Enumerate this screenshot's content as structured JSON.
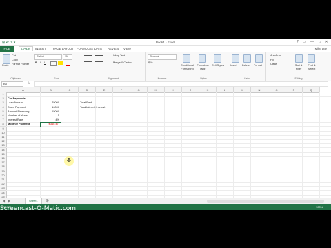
{
  "window": {
    "title": "Book1 - Excel",
    "user": "Mike Lee"
  },
  "quick_access": "⊞ ↶ ↷ ▾",
  "controls": [
    "?",
    "▭",
    "—",
    "□",
    "✕"
  ],
  "tabs": [
    "FILE",
    "HOME",
    "INSERT",
    "PAGE LAYOUT",
    "FORMULAS",
    "DATA",
    "REVIEW",
    "VIEW"
  ],
  "ribbon": {
    "clipboard": {
      "paste": "Paste",
      "cut": "Cut",
      "copy": "Copy",
      "format_painter": "Format Painter",
      "label": "Clipboard"
    },
    "font": {
      "name": "Calibri",
      "size": "11",
      "bold": "B",
      "italic": "I",
      "underline": "U",
      "label": "Font"
    },
    "alignment": {
      "wrap": "Wrap Text",
      "merge": "Merge & Center",
      "label": "Alignment"
    },
    "number": {
      "format": "General",
      "label": "Number"
    },
    "styles": {
      "conditional": "Conditional Formatting",
      "format_table": "Format as Table",
      "cell_styles": "Cell Styles",
      "label": "Styles"
    },
    "cells": {
      "insert": "Insert",
      "delete": "Delete",
      "format": "Format",
      "label": "Cells"
    },
    "editing": {
      "autosum": "AutoSum",
      "fill": "Fill",
      "clear": "Clear",
      "sort": "Sort & Filter",
      "find": "Find & Select",
      "label": "Editing"
    }
  },
  "formula_bar": {
    "name_box": "B8",
    "fx": "fx",
    "value": ""
  },
  "columns": [
    "A",
    "B",
    "C",
    "D",
    "E",
    "F",
    "G",
    "H",
    "I",
    "J",
    "K",
    "L",
    "M",
    "N",
    "O",
    "P",
    "Q"
  ],
  "rows": [
    "1",
    "2",
    "3",
    "4",
    "5",
    "6",
    "7",
    "8",
    "9",
    "10",
    "11",
    "12",
    "13",
    "14",
    "15",
    "16",
    "17",
    "18",
    "19",
    "20",
    "21",
    "22",
    "23",
    "24",
    "25"
  ],
  "cells": {
    "A2": "Car Payments",
    "A3": "Loan Amount",
    "B3": "25000",
    "D3": "Total Paid",
    "A4": "Down Payment",
    "B4": "10000",
    "D4": "Total Interest Interest",
    "A5": "Amount Financing",
    "B5": "15000",
    "A6": "Number of Years",
    "B6": "5",
    "A7": "Interest Rate",
    "B7": "4%",
    "A8": "Monthly Payment",
    "B8": "($340.47)"
  },
  "sheet_tab": "Sheet1",
  "status": {
    "left": "READY",
    "zoom": "100%"
  },
  "watermark": "Screencast-O-Matic.com"
}
